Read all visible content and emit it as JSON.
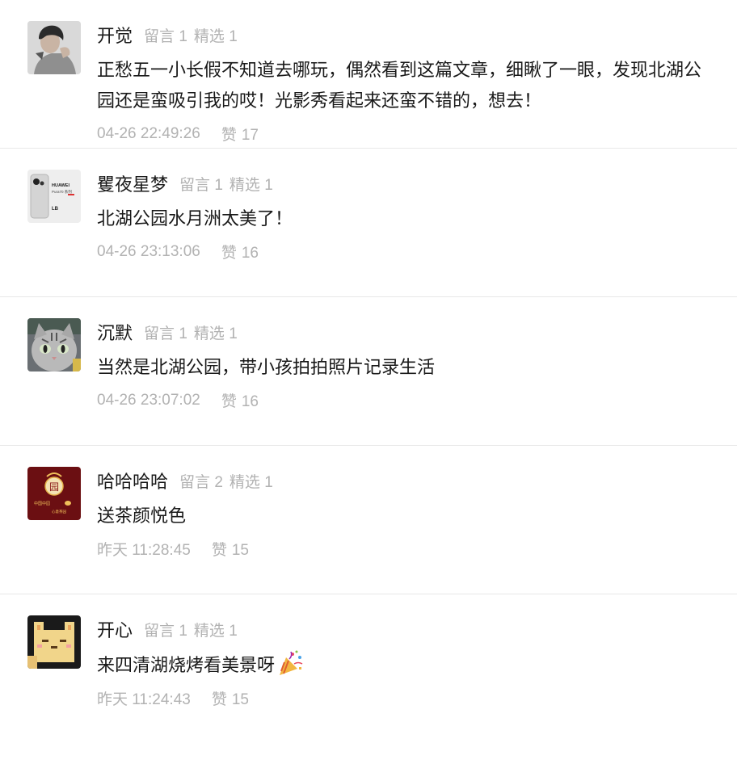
{
  "comments": [
    {
      "nickname": "开觉",
      "messages_label": "留言",
      "messages_count": "1",
      "featured_label": "精选",
      "featured_count": "1",
      "text": "正愁五一小长假不知道去哪玩，偶然看到这篇文章，细瞅了一眼，发现北湖公园还是蛮吸引我的哎！光影秀看起来还蛮不错的，想去！",
      "time": "04-26 22:49:26",
      "like_label": "赞",
      "like_count": "17",
      "avatar_icon": "person-photo-icon"
    },
    {
      "nickname": "矍夜星梦",
      "messages_label": "留言",
      "messages_count": "1",
      "featured_label": "精选",
      "featured_count": "1",
      "text": "北湖公园水月洲太美了！",
      "time": "04-26 23:13:06",
      "like_label": "赞",
      "like_count": "16",
      "avatar_icon": "phone-photo-icon",
      "avatar_text": {
        "brand": "HUAWEI",
        "model": "Pura70 系列",
        "lb": "LB"
      }
    },
    {
      "nickname": "沉默",
      "messages_label": "留言",
      "messages_count": "1",
      "featured_label": "精选",
      "featured_count": "1",
      "text": "当然是北湖公园，带小孩拍拍照片记录生活",
      "time": "04-26 23:07:02",
      "like_label": "赞",
      "like_count": "16",
      "avatar_icon": "cat-photo-icon"
    },
    {
      "nickname": "哈哈哈哈",
      "messages_label": "留言",
      "messages_count": "2",
      "featured_label": "精选",
      "featured_count": "1",
      "text": "送茶颜悦色",
      "time": "昨天 11:28:45",
      "like_label": "赞",
      "like_count": "15",
      "avatar_icon": "tea-brand-logo-icon",
      "avatar_text": {
        "seal": "园",
        "left": "中国中园",
        "right": "心意茶园"
      }
    },
    {
      "nickname": "开心",
      "messages_label": "留言",
      "messages_count": "1",
      "featured_label": "精选",
      "featured_count": "1",
      "text": "来四清湖烧烤看美景呀",
      "time": "昨天 11:24:43",
      "like_label": "赞",
      "like_count": "15",
      "avatar_icon": "pixel-cat-icon",
      "emoji": "party-popper-icon"
    }
  ],
  "colors": {
    "primary_text": "#191919",
    "secondary_text": "#b2b2b2",
    "divider": "#e8e8e8",
    "background": "#ffffff"
  }
}
